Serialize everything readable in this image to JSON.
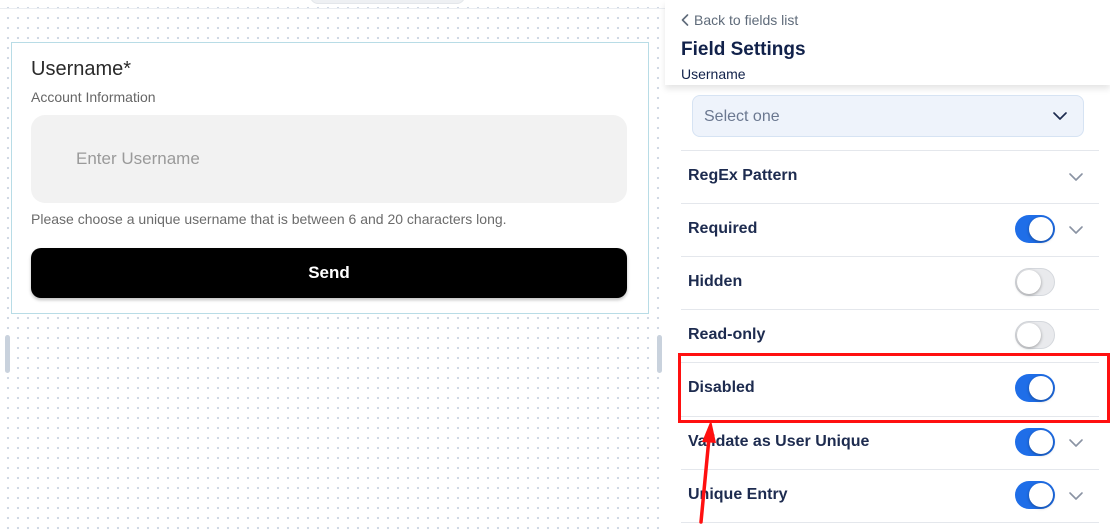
{
  "canvas": {
    "form": {
      "label": "Username*",
      "sublabel": "Account Information",
      "input_placeholder": "Enter Username",
      "help_text": "Please choose a unique username that is between 6 and 20 characters long.",
      "submit_label": "Send"
    }
  },
  "panel": {
    "back_label": "Back to fields list",
    "title": "Field Settings",
    "subtitle": "Username",
    "select": {
      "placeholder": "Select one"
    },
    "rows": [
      {
        "label": "RegEx Pattern"
      },
      {
        "label": "Required",
        "toggle": "on"
      },
      {
        "label": "Hidden",
        "toggle": "off"
      },
      {
        "label": "Read-only",
        "toggle": "off"
      },
      {
        "label": "Disabled",
        "toggle": "on"
      },
      {
        "label": "Validate as User Unique",
        "toggle": "on"
      },
      {
        "label": "Unique Entry",
        "toggle": "on"
      }
    ]
  },
  "icons": {
    "back": "chevron-left-icon",
    "expand": "chevron-down-icon"
  },
  "colors": {
    "toggle_on": "#1f6ee8",
    "toggle_off": "#e9eaed",
    "annotation": "#ff1010",
    "submit_bg": "#000000",
    "panel_text": "#1d2b4f"
  }
}
